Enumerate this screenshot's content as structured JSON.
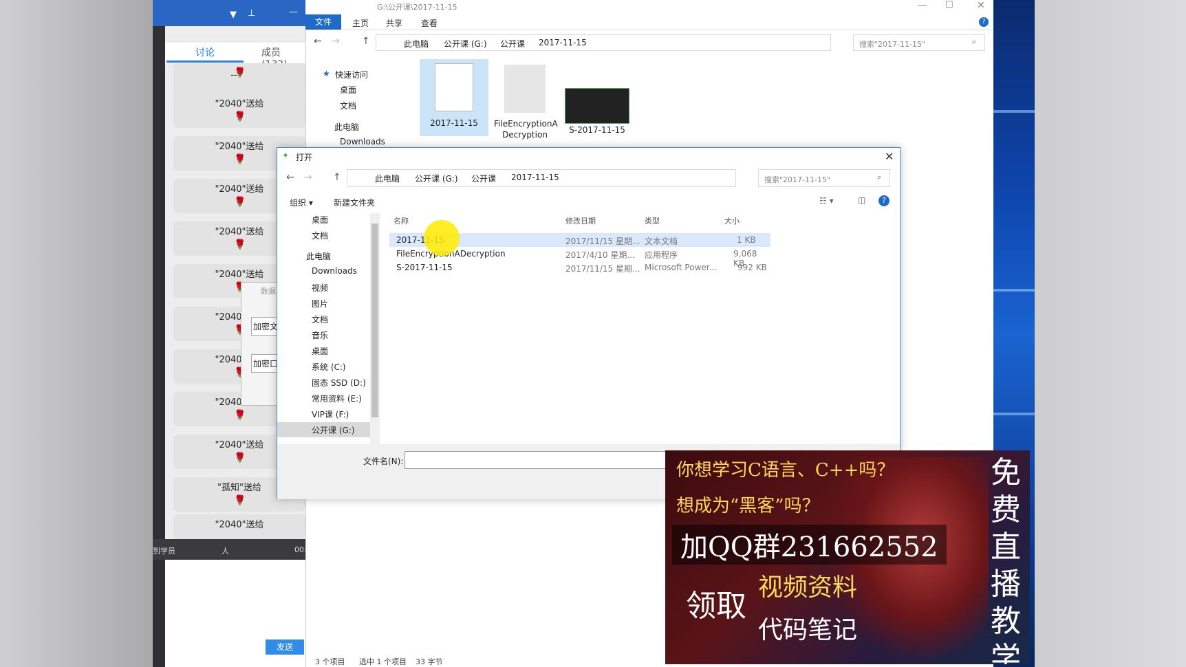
{
  "chat": {
    "tabs": {
      "discuss": "讨论",
      "members": "成员(132)"
    },
    "messages": [
      {
        "text": "--"
      },
      {
        "text": "\"2040\"送给"
      },
      {
        "text": "\"2040\"送给"
      },
      {
        "text": "\"2040\"送给"
      },
      {
        "text": "\"2040\"送给"
      },
      {
        "text": "\"2040\"送给"
      },
      {
        "text": "\"2040\"送给"
      },
      {
        "text": "\"2040\"送给"
      },
      {
        "text": "\"2040\"送给"
      },
      {
        "text": "\"2040\"送给"
      },
      {
        "text": "\"孤知\"送给"
      },
      {
        "text": "\"2040\"送给"
      }
    ],
    "rose": "🌹",
    "popup_items": [
      "数据",
      "加密文",
      "加密口"
    ],
    "bottombar": {
      "left": "到学员",
      "mid": "人",
      "right": "00:"
    },
    "send": "发送"
  },
  "explorer": {
    "title": "G:\\公开课\\2017-11-15",
    "ribbon": [
      "文件",
      "主页",
      "共享",
      "查看"
    ],
    "path": [
      "此电脑",
      "公开课 (G:)",
      "公开课",
      "2017-11-15"
    ],
    "search_placeholder": "搜索\"2017-11-15\"",
    "nav": {
      "quick": "快速访问",
      "desktop": "桌面",
      "docs": "文档",
      "pc": "此电脑",
      "downloads": "Downloads"
    },
    "tiles": [
      "2017-11-15",
      "FileEncryptionA Decryption",
      "S-2017-11-15"
    ],
    "status": {
      "count": "3 个项目",
      "selected": "选中 1 个项目",
      "size": "33 字节"
    }
  },
  "dialog": {
    "title": "打开",
    "path": [
      "此电脑",
      "公开课 (G:)",
      "公开课",
      "2017-11-15"
    ],
    "search_placeholder": "搜索\"2017-11-15\"",
    "organize": "组织 ▾",
    "new_folder": "新建文件夹",
    "tree": [
      "桌面",
      "文档",
      "此电脑",
      "Downloads",
      "视频",
      "图片",
      "文档",
      "音乐",
      "桌面",
      "系统 (C:)",
      "固态 SSD (D:)",
      "常用资料 (E:)",
      "VIP课 (F:)",
      "公开课 (G:)"
    ],
    "columns": [
      "名称",
      "修改日期",
      "类型",
      "大小"
    ],
    "files": [
      {
        "name": "2017-11-15",
        "date": "2017/11/15 星期...",
        "type": "文本文档",
        "size": "1 KB"
      },
      {
        "name": "FileEncryptionADecryption",
        "date": "2017/4/10 星期...",
        "type": "应用程序",
        "size": "9,068 KB"
      },
      {
        "name": "S-2017-11-15",
        "date": "2017/11/15 星期...",
        "type": "Microsoft Power...",
        "size": "992 KB"
      }
    ],
    "filename_label": "文件名(N):"
  },
  "ad": {
    "line1": "你想学习C语言、C++吗？",
    "line2": "想成为“黑客”吗？",
    "qq": "加QQ群231662552",
    "get": "领取",
    "video": "视频资料",
    "notes": "代码笔记",
    "vertical": "免费直播教学"
  }
}
